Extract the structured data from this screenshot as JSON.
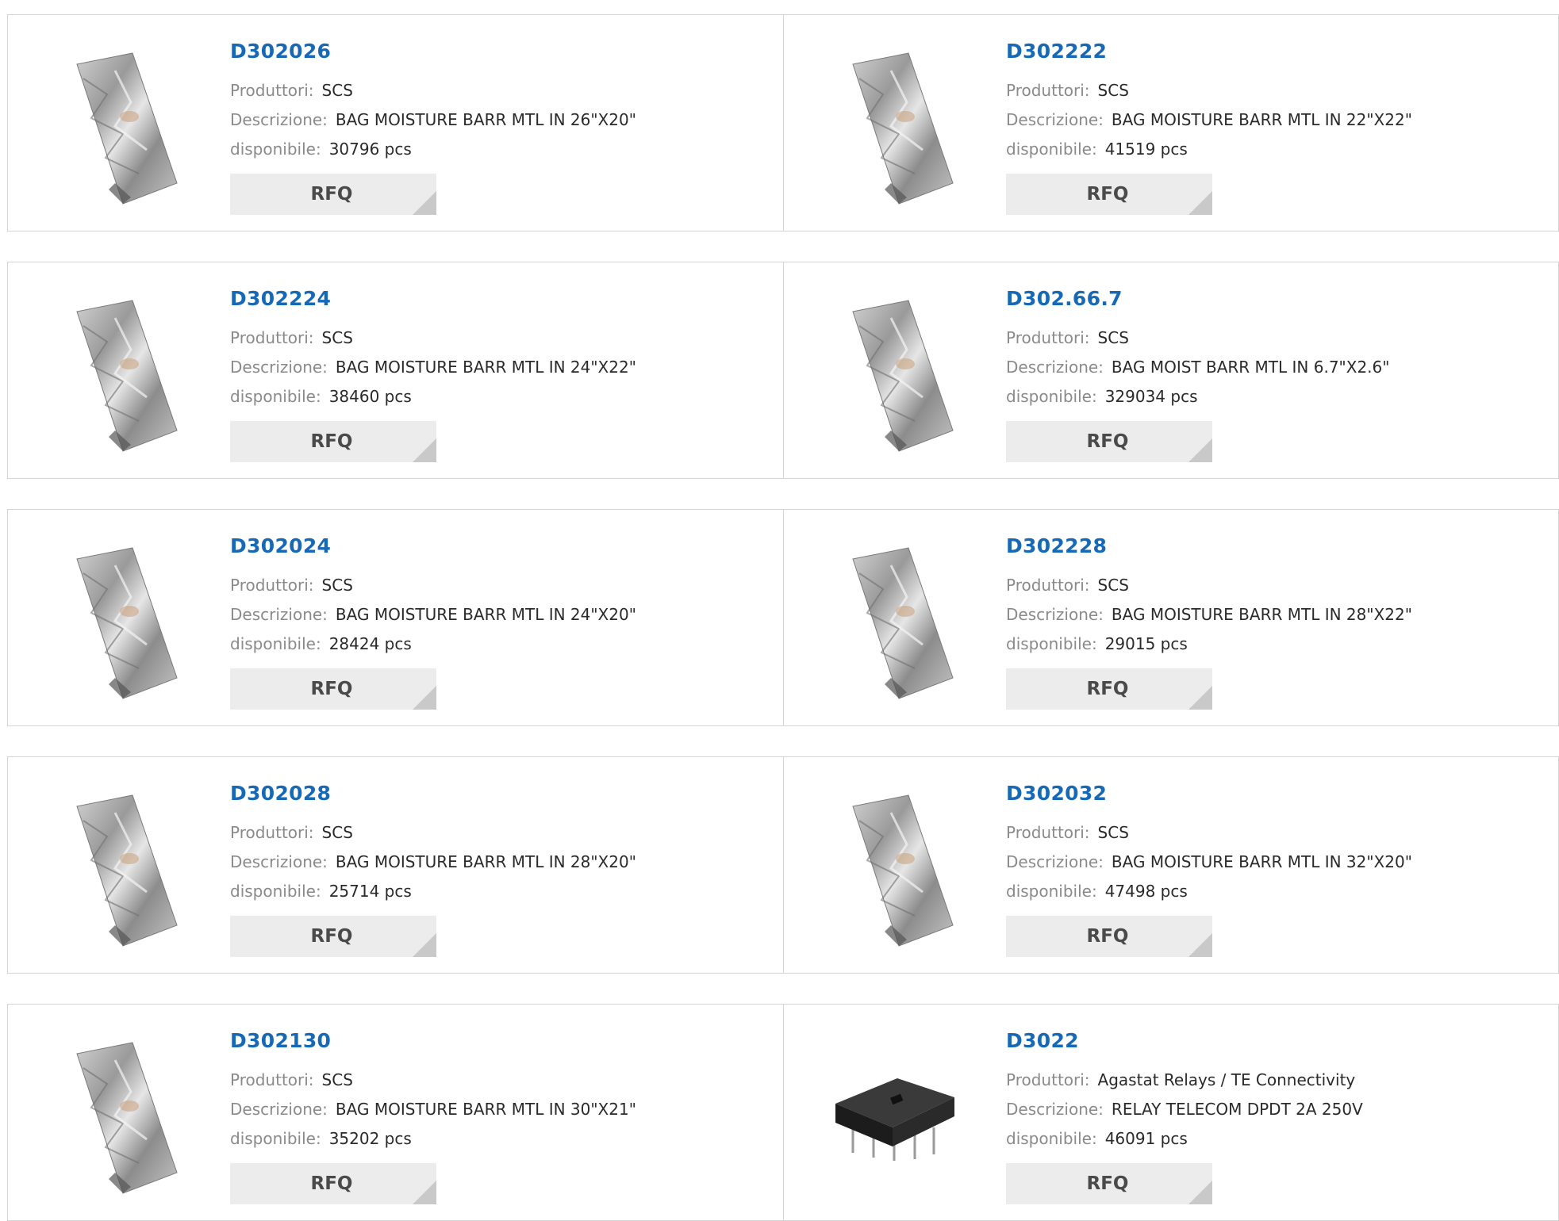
{
  "labels": {
    "manufacturer": "Produttori:",
    "description": "Descrizione:",
    "available": "disponibile:",
    "rfq": "RFQ"
  },
  "products": [
    {
      "part": "D302026",
      "manufacturer": "SCS",
      "description": "BAG MOISTURE BARR MTL IN 26\"X20\"",
      "stock": "30796 pcs",
      "image": "bag-icon"
    },
    {
      "part": "D302222",
      "manufacturer": "SCS",
      "description": "BAG MOISTURE BARR MTL IN 22\"X22\"",
      "stock": "41519 pcs",
      "image": "bag-icon"
    },
    {
      "part": "D302224",
      "manufacturer": "SCS",
      "description": "BAG MOISTURE BARR MTL IN 24\"X22\"",
      "stock": "38460 pcs",
      "image": "bag-icon"
    },
    {
      "part": "D302.66.7",
      "manufacturer": "SCS",
      "description": "BAG MOIST BARR MTL IN 6.7\"X2.6\"",
      "stock": "329034 pcs",
      "image": "bag-icon"
    },
    {
      "part": "D302024",
      "manufacturer": "SCS",
      "description": "BAG MOISTURE BARR MTL IN 24\"X20\"",
      "stock": "28424 pcs",
      "image": "bag-icon"
    },
    {
      "part": "D302228",
      "manufacturer": "SCS",
      "description": "BAG MOISTURE BARR MTL IN 28\"X22\"",
      "stock": "29015 pcs",
      "image": "bag-icon"
    },
    {
      "part": "D302028",
      "manufacturer": "SCS",
      "description": "BAG MOISTURE BARR MTL IN 28\"X20\"",
      "stock": "25714 pcs",
      "image": "bag-icon"
    },
    {
      "part": "D302032",
      "manufacturer": "SCS",
      "description": "BAG MOISTURE BARR MTL IN 32\"X20\"",
      "stock": "47498 pcs",
      "image": "bag-icon"
    },
    {
      "part": "D302130",
      "manufacturer": "SCS",
      "description": "BAG MOISTURE BARR MTL IN 30\"X21\"",
      "stock": "35202 pcs",
      "image": "bag-icon"
    },
    {
      "part": "D3022",
      "manufacturer": "Agastat Relays / TE Connectivity",
      "description": "RELAY TELECOM DPDT 2A 250V",
      "stock": "46091 pcs",
      "image": "relay-icon"
    }
  ],
  "colors": {
    "title": "#1769b5",
    "label": "#8a8a8a",
    "button_bg": "#ececec",
    "border": "#d4d4d4"
  }
}
